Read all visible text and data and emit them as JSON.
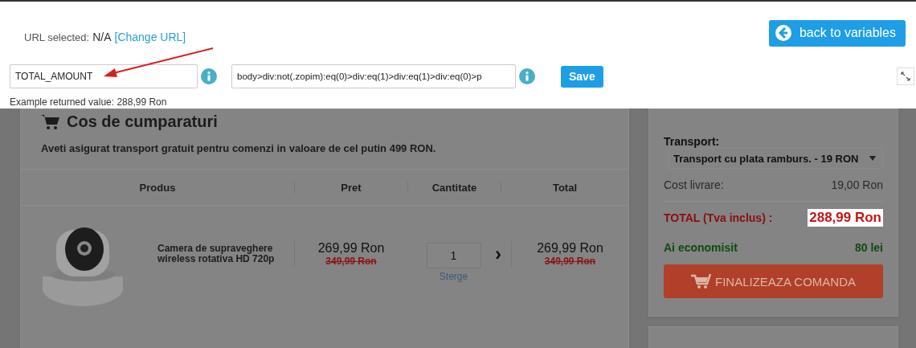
{
  "url_bar": {
    "label": "URL selected:",
    "value": "N/A",
    "link": "[Change URL]"
  },
  "back_button": {
    "label": "back to variables"
  },
  "variable": {
    "name": "TOTAL_AMOUNT",
    "selector": "body>div:not(.zopim):eq(0)>div:eq(1)>div:eq(1)>div:eq(0)>p",
    "save": "Save",
    "example": "Example returned value: 288,99 Ron"
  },
  "cart": {
    "title": "Cos de cumparaturi",
    "notice": "Aveti asigurat transport gratuit pentru comenzi in valoare de cel putin 499 RON.",
    "columns": [
      "Produs",
      "Pret",
      "Cantitate",
      "Total"
    ],
    "rows": [
      {
        "kind": "picture",
        "product": "Camera de supraveghere wireless rotativa HD 720p",
        "price": "269,99 Ron",
        "old_price": "349,99 Ron",
        "quantity": "1",
        "remove": "Sterge",
        "arrow": "›",
        "total": "269,99 Ron",
        "old_total": "349,99 Ron"
      }
    ]
  },
  "summary": {
    "transport_label": "Transport:",
    "transport_option": "Transport cu plata ramburs. - 19 RON",
    "rows": [
      {
        "kind": "cost",
        "label": "Cost livrare:",
        "value": "19,00 Ron",
        "highlighted": false
      },
      {
        "kind": "total",
        "label": "TOTAL (Tva inclus) :",
        "value": "288,99 Ron",
        "highlighted": true
      },
      {
        "kind": "savings",
        "label": "Ai economisit",
        "value": "80 lei",
        "highlighted": false
      }
    ],
    "checkout": "FINALIZEAZA COMANDA"
  }
}
